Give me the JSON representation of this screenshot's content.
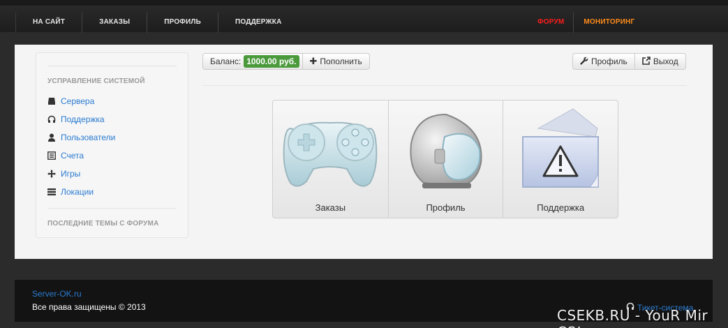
{
  "nav": {
    "left": [
      "НА САЙТ",
      "ЗАКАЗЫ",
      "ПРОФИЛЬ",
      "ПОДДЕРЖКА"
    ],
    "forum": "ФОРУМ",
    "monitoring": "МОНИТОРИНГ"
  },
  "sidebar": {
    "header": "УСПРАВЛЕНИЕ СИСТЕМОЙ",
    "items": [
      {
        "label": "Сервера",
        "icon": "hdd-icon"
      },
      {
        "label": "Поддержка",
        "icon": "headphones-icon"
      },
      {
        "label": "Пользователи",
        "icon": "user-icon"
      },
      {
        "label": "Счета",
        "icon": "list-alt-icon"
      },
      {
        "label": "Игры",
        "icon": "move-icon"
      },
      {
        "label": "Локации",
        "icon": "list-icon"
      }
    ],
    "footer_header": "ПОСЛЕДНИЕ ТЕМЫ С ФОРУМА"
  },
  "toolbar": {
    "balance_label": "Баланс:",
    "balance_value": "1000.00 руб.",
    "topup_label": "Пополнить",
    "profile_label": "Профиль",
    "logout_label": "Выход"
  },
  "tiles": [
    {
      "label": "Заказы",
      "icon": "gamepad-icon"
    },
    {
      "label": "Профиль",
      "icon": "helmet-icon"
    },
    {
      "label": "Поддержка",
      "icon": "warning-icon"
    }
  ],
  "footer": {
    "site_link": "Server-OK.ru",
    "copyright": "Все права защищены © 2013",
    "ticket": "Тикет-система"
  },
  "watermark": "CSEKB.RU -  YouR Mir CS!",
  "colors": {
    "accent_link": "#2a7bd0",
    "forum": "#ff1c1c",
    "monitoring": "#ff8c1a",
    "balance_badge": "#4a9a3c"
  }
}
